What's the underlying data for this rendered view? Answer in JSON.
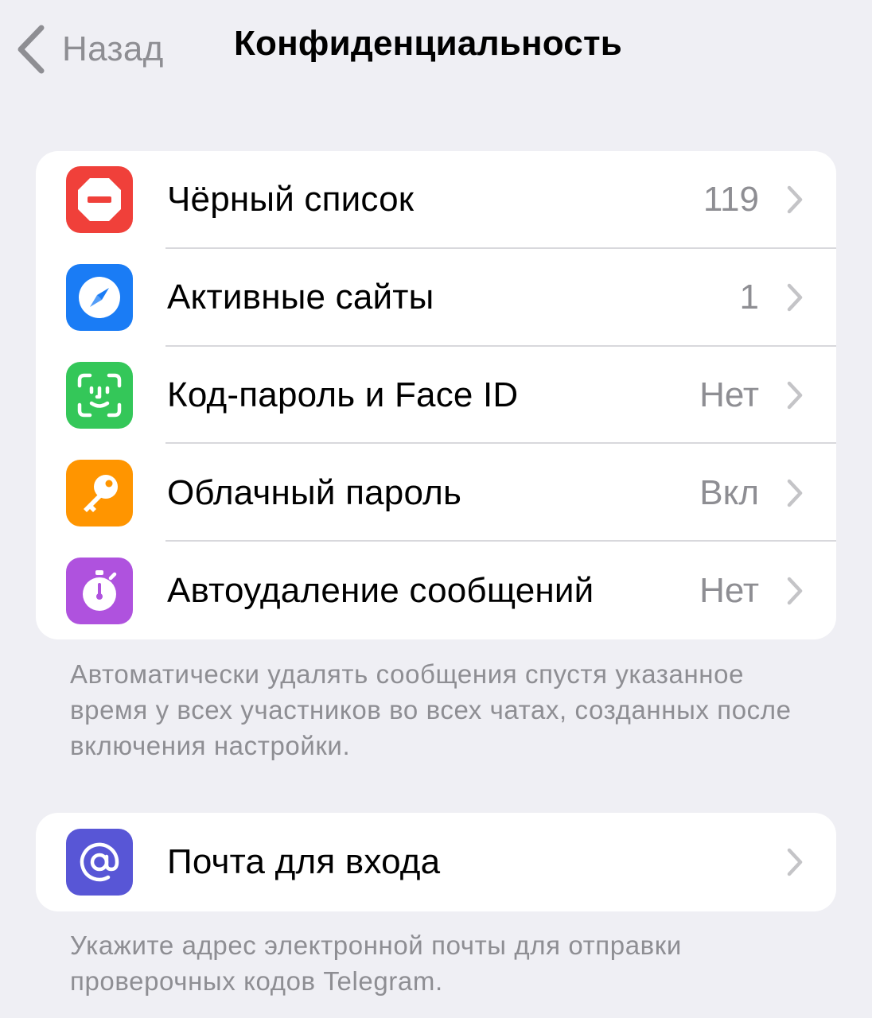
{
  "nav": {
    "back_label": "Назад",
    "title": "Конфиденциальность"
  },
  "privacy_group": {
    "items": [
      {
        "label": "Чёрный список",
        "value": "119",
        "icon": "blocked-icon",
        "icon_color": "#F0403A"
      },
      {
        "label": "Активные сайты",
        "value": "1",
        "icon": "compass-icon",
        "icon_color": "#1A7CF5"
      },
      {
        "label": "Код-пароль и Face ID",
        "value": "Нет",
        "icon": "face-id-icon",
        "icon_color": "#34C759"
      },
      {
        "label": "Облачный пароль",
        "value": "Вкл",
        "icon": "key-icon",
        "icon_color": "#FF9500"
      },
      {
        "label": "Автоудаление сообщений",
        "value": "Нет",
        "icon": "timer-icon",
        "icon_color": "#AF52DE"
      }
    ],
    "footnote": "Автоматически удалять сообщения спустя указанное время у всех участников во всех чатах, созданных после включения настройки."
  },
  "email_group": {
    "items": [
      {
        "label": "Почта для входа",
        "icon": "at-sign-icon",
        "icon_color": "#5856D6"
      }
    ],
    "footnote": "Укажите адрес электронной почты для отправки проверочных кодов Telegram."
  },
  "colors": {
    "background": "#EFEFF4",
    "secondary_text": "#8E8E93",
    "chevron": "#C4C4C7"
  }
}
